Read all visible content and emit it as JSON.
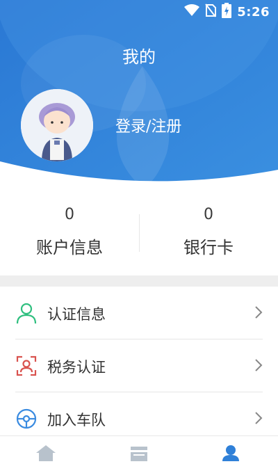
{
  "colors": {
    "header_blue": "#2f80d8",
    "accent_green": "#2fbf7f",
    "accent_red": "#d9534f",
    "accent_blue": "#3a8be0",
    "tab_active": "#2f80d8",
    "tab_inactive": "#b8c2cc"
  },
  "status_bar": {
    "time": "5:26",
    "icons": [
      "wifi-icon",
      "no-sim-icon",
      "battery-charging-icon"
    ]
  },
  "header": {
    "title": "我的",
    "login_label": "登录/注册",
    "avatar_icon": "user-avatar-icon"
  },
  "stats": [
    {
      "value": "0",
      "label": "账户信息"
    },
    {
      "value": "0",
      "label": "银行卡"
    }
  ],
  "menu": [
    {
      "label": "认证信息",
      "icon": "person-icon"
    },
    {
      "label": "税务认证",
      "icon": "id-scan-icon"
    },
    {
      "label": "加入车队",
      "icon": "steering-wheel-icon"
    }
  ],
  "tabbar": {
    "tabs": [
      {
        "icon": "home-icon"
      },
      {
        "icon": "list-icon"
      },
      {
        "icon": "profile-icon"
      }
    ],
    "active_index": 2
  }
}
